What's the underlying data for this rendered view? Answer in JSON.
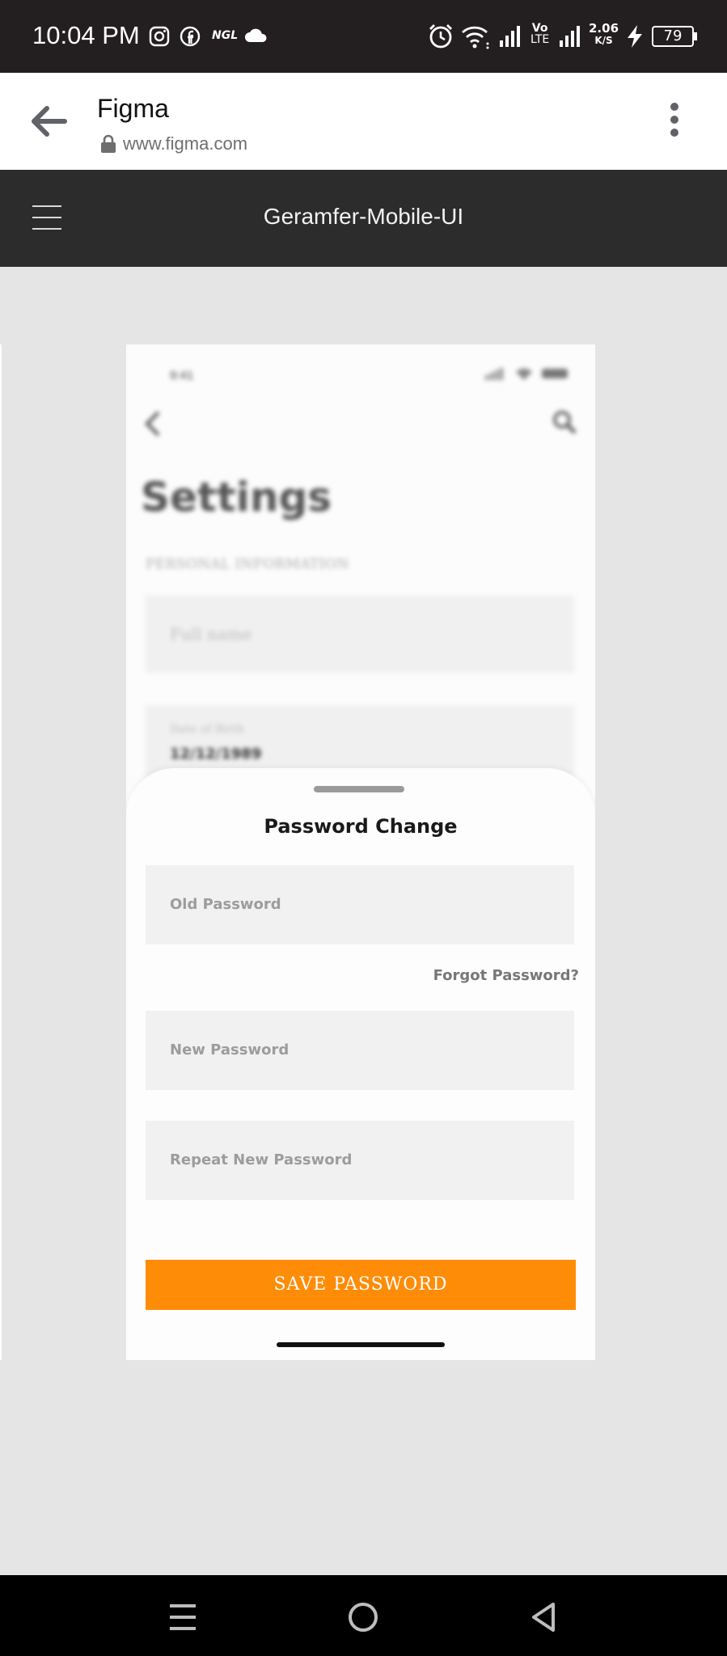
{
  "status_bar": {
    "time": "10:04 PM",
    "ngl_label": "NGL",
    "volte_top": "Vo",
    "volte_bottom": "LTE",
    "speed_value": "2.06",
    "speed_unit": "K/S",
    "battery": "79",
    "icons": [
      "instagram-icon",
      "facebook-icon",
      "ngl-icon",
      "cloud-icon",
      "alarm-icon",
      "wifi-icon",
      "signal-icon",
      "volte-icon",
      "signal-icon",
      "charging-icon",
      "battery-icon"
    ]
  },
  "browser": {
    "title": "Figma",
    "url": "www.figma.com"
  },
  "figma": {
    "title": "Geramfer-Mobile-UI"
  },
  "phone": {
    "time": "9:41",
    "heading": "Settings",
    "section_label": "PERSONAL INFORMATION",
    "full_name_placeholder": "Full name",
    "dob_label": "Date of Birth",
    "dob_value": "12/12/1989",
    "sheet": {
      "title": "Password Change",
      "old_password_placeholder": "Old Password",
      "forgot_label": "Forgot Password?",
      "new_password_placeholder": "New Password",
      "repeat_password_placeholder": "Repeat New Password",
      "save_label": "SAVE PASSWORD"
    }
  },
  "colors": {
    "accent": "#ff8c07",
    "status_bar_bg": "#231f20",
    "figma_header_bg": "#2c2c2c",
    "canvas_bg": "#e5e5e5"
  }
}
